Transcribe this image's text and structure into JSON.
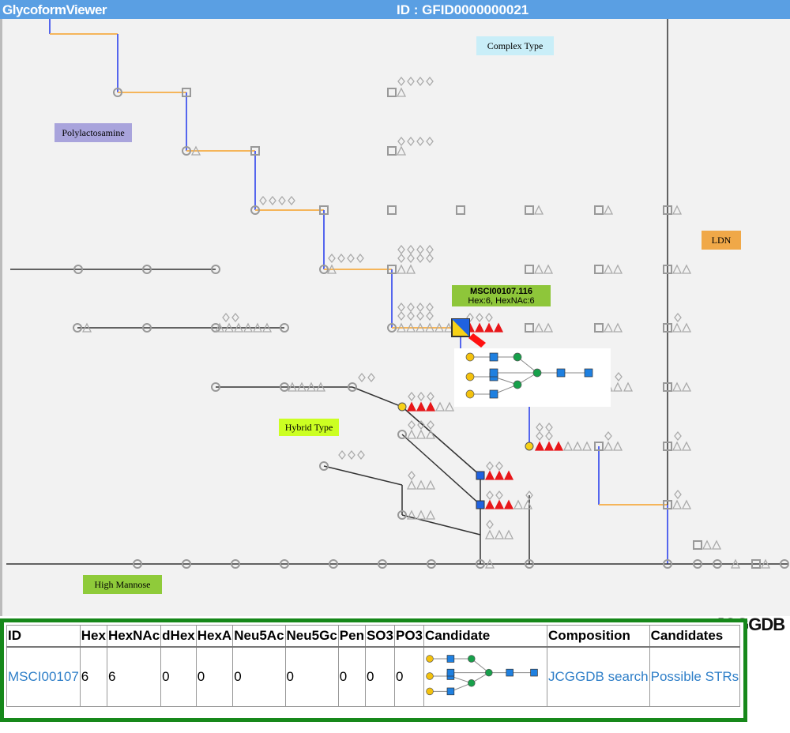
{
  "header": {
    "app_title": "GlycoformViewer",
    "id_label": "ID : GFID0000000021"
  },
  "labels": {
    "complex": "Complex Type",
    "polylactosamine": "Polylactosamine",
    "ldn": "LDN",
    "hybrid": "Hybrid Type",
    "high_mannose": "High Mannose"
  },
  "tooltip": {
    "id": "MSCI00107.116",
    "composition": "Hex:6, HexNAc:6"
  },
  "logo": "JCGGDB",
  "colors": {
    "header": "#5a9fe3",
    "table_border": "#16881a",
    "link": "#2f7fc8",
    "hex": "#f7d117",
    "hexnac": "#1f62e0",
    "fucose": "#e8171a",
    "mannose": "#17a04a"
  },
  "table": {
    "headers": [
      "ID",
      "Hex",
      "HexNAc",
      "dHex",
      "HexA",
      "Neu5Ac",
      "Neu5Gc",
      "Pen",
      "SO3",
      "PO3",
      "Candidate",
      "Composition",
      "Candidates"
    ],
    "row": {
      "id": "MSCI00107",
      "hex": "6",
      "hexnac": "6",
      "dhex": "0",
      "hexa": "0",
      "neu5ac": "0",
      "neu5gc": "0",
      "pen": "0",
      "so3": "0",
      "po3": "0",
      "composition": "JCGGDB search",
      "candidates": "Possible STRs"
    }
  }
}
